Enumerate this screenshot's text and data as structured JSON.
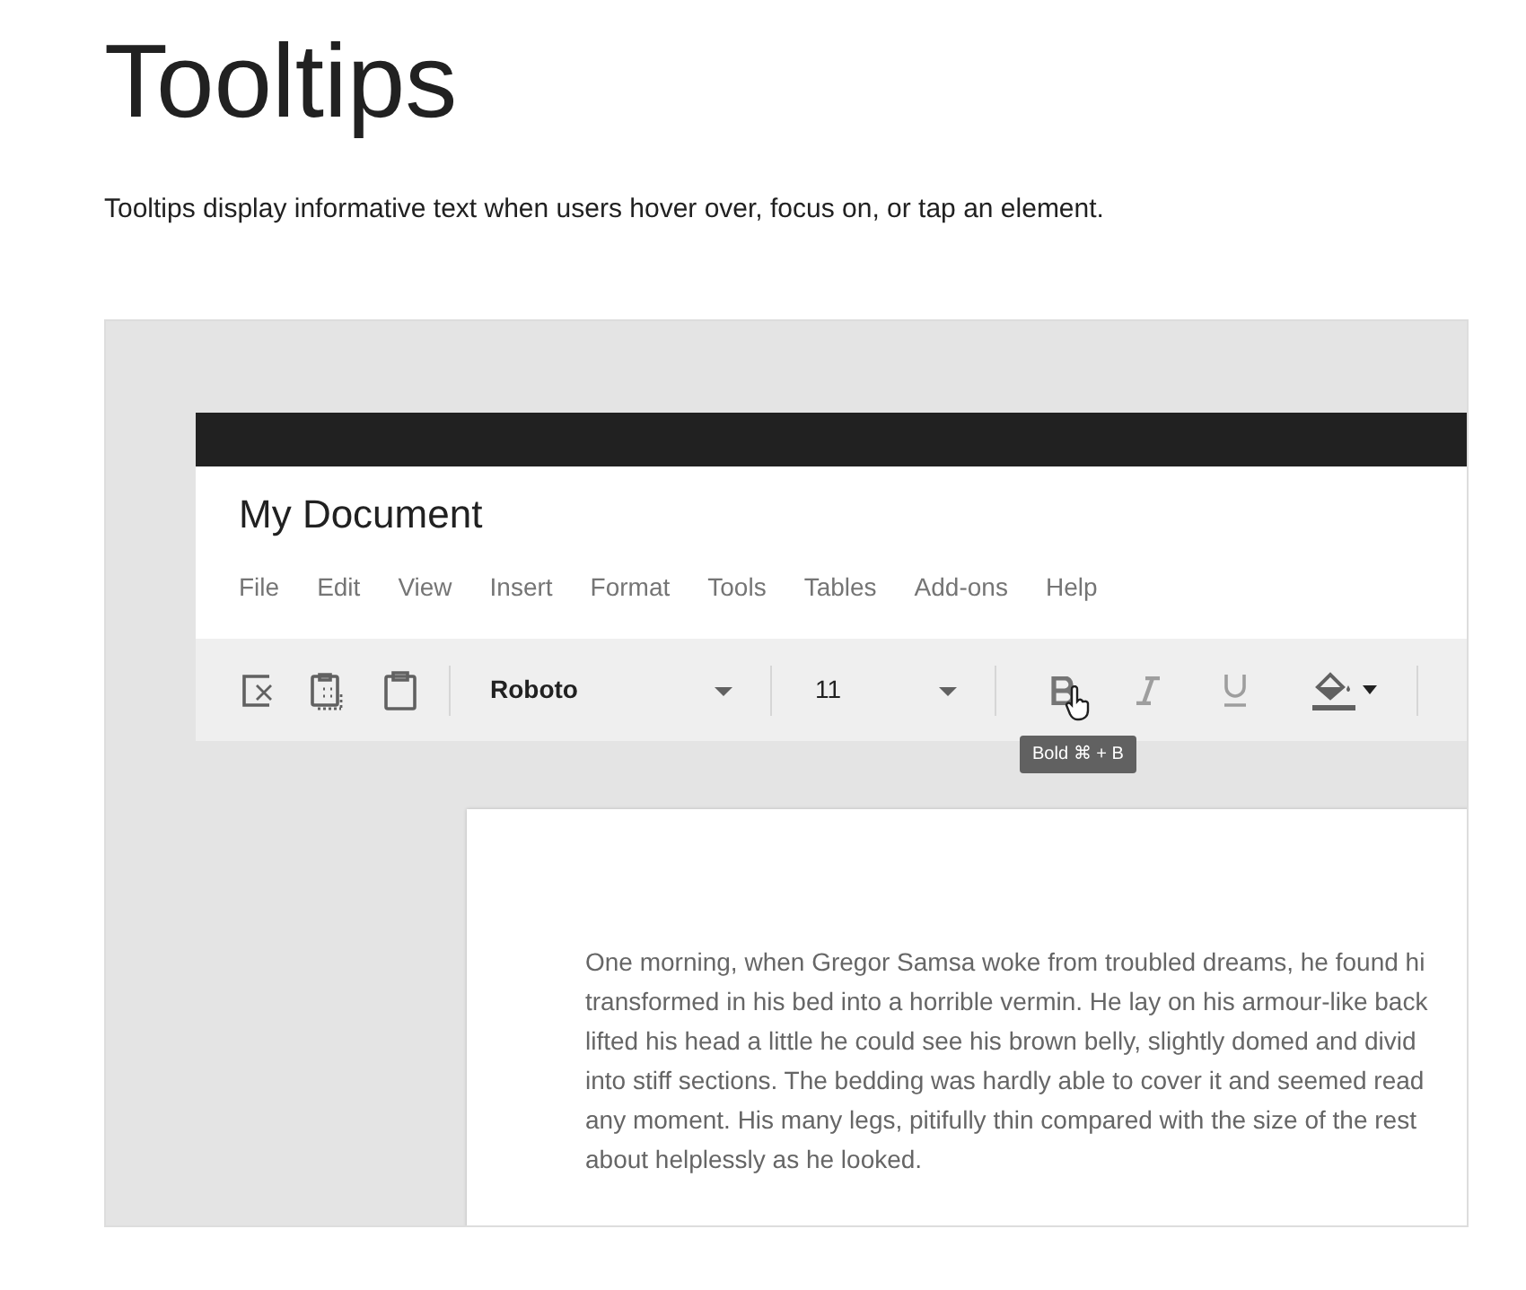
{
  "title": "Tooltips",
  "description": "Tooltips display informative text when users hover over, focus on, or tap an element.",
  "demo": {
    "doc_title": "My Document",
    "menu": [
      "File",
      "Edit",
      "View",
      "Insert",
      "Format",
      "Tools",
      "Tables",
      "Add-ons",
      "Help"
    ],
    "toolbar": {
      "font": "Roboto",
      "size": "11",
      "tooltip": "Bold ⌘ + B"
    },
    "page_lines": [
      "One morning, when Gregor Samsa woke from troubled dreams, he found hi",
      "transformed in his bed into a horrible vermin. He lay on his armour-like back",
      "lifted his head a little he could see his brown belly, slightly domed and divid",
      "into stiff sections. The bedding was hardly able to cover it and seemed read",
      "any moment. His many legs, pitifully thin compared with the size of the rest",
      "about helplessly as he looked."
    ]
  }
}
